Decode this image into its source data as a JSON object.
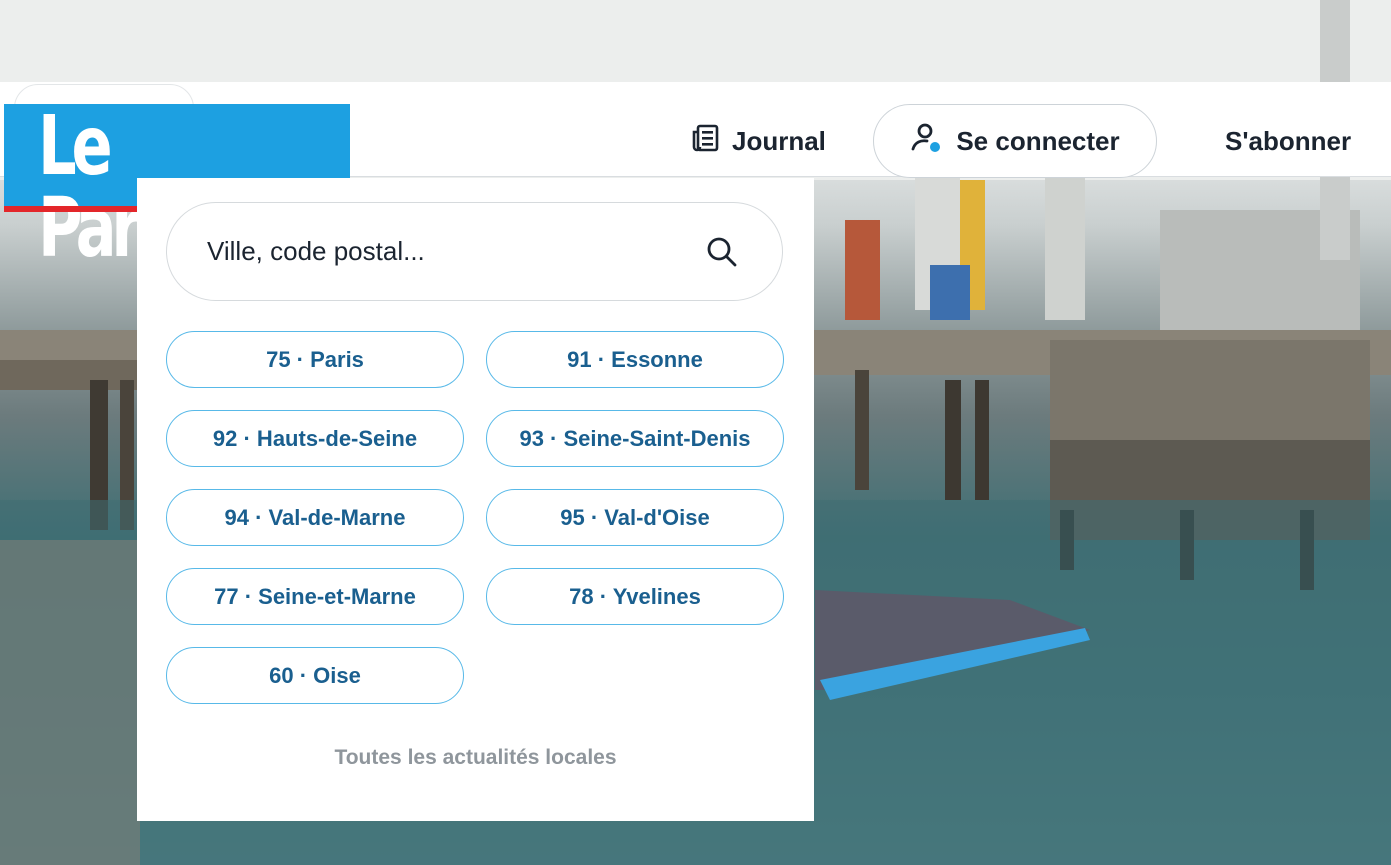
{
  "header": {
    "logo_text": "Le Parisien",
    "journal_label": "Journal",
    "connect_label": "Se connecter",
    "subscribe_label": "S'abonner"
  },
  "search": {
    "placeholder": "Ville, code postal..."
  },
  "departments": [
    "75 · Paris",
    "91 · Essonne",
    "92 · Hauts-de-Seine",
    "93 · Seine-Saint-Denis",
    "94 · Val-de-Marne",
    "95 · Val-d'Oise",
    "77 · Seine-et-Marne",
    "78 · Yvelines",
    "60 · Oise"
  ],
  "footer": {
    "all_local_news": "Toutes les actualités locales"
  },
  "colors": {
    "brand_blue": "#1da0e1",
    "brand_red": "#e3262a",
    "pill_border": "#58b9e8",
    "pill_text": "#1a5f8f",
    "text_dark": "#1b2430",
    "muted": "#8f969c"
  },
  "icons": {
    "journal": "newspaper-icon",
    "connect": "user-icon",
    "search": "search-icon"
  }
}
